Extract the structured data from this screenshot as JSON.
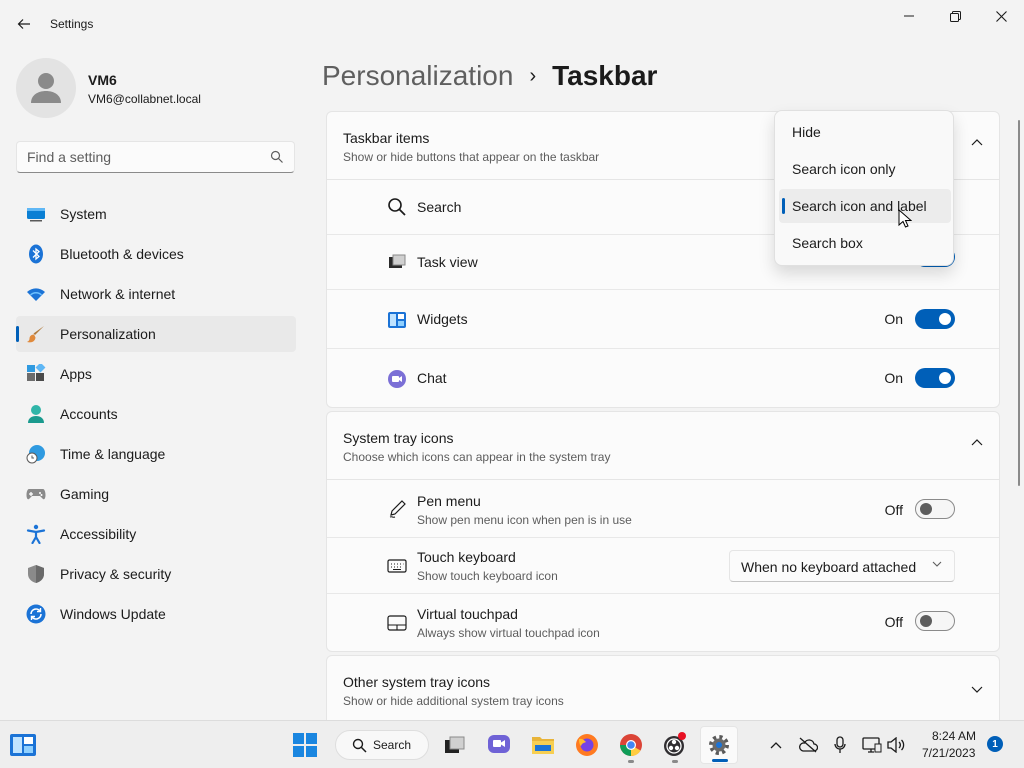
{
  "window": {
    "title": "Settings"
  },
  "profile": {
    "name": "VM6",
    "email": "VM6@collabnet.local"
  },
  "search": {
    "placeholder": "Find a setting"
  },
  "sidebar": {
    "items": [
      {
        "label": "System",
        "icon": "system-icon"
      },
      {
        "label": "Bluetooth & devices",
        "icon": "bluetooth-icon"
      },
      {
        "label": "Network & internet",
        "icon": "wifi-icon"
      },
      {
        "label": "Personalization",
        "icon": "brush-icon",
        "selected": true
      },
      {
        "label": "Apps",
        "icon": "apps-icon"
      },
      {
        "label": "Accounts",
        "icon": "accounts-icon"
      },
      {
        "label": "Time & language",
        "icon": "globe-clock-icon"
      },
      {
        "label": "Gaming",
        "icon": "gamepad-icon"
      },
      {
        "label": "Accessibility",
        "icon": "accessibility-icon"
      },
      {
        "label": "Privacy & security",
        "icon": "shield-icon"
      },
      {
        "label": "Windows Update",
        "icon": "update-icon"
      }
    ]
  },
  "breadcrumb": {
    "parent": "Personalization",
    "current": "Taskbar"
  },
  "taskbar_items": {
    "title": "Taskbar items",
    "subtitle": "Show or hide buttons that appear on the taskbar",
    "rows": [
      {
        "label": "Search",
        "icon": "search-icon"
      },
      {
        "label": "Task view",
        "icon": "task-view-icon"
      },
      {
        "label": "Widgets",
        "state": "On",
        "on": true,
        "icon": "widgets-icon"
      },
      {
        "label": "Chat",
        "state": "On",
        "on": true,
        "icon": "chat-icon"
      }
    ]
  },
  "search_flyout": {
    "options": [
      "Hide",
      "Search icon only",
      "Search icon and label",
      "Search box"
    ],
    "selected": "Search icon and label"
  },
  "system_tray": {
    "title": "System tray icons",
    "subtitle": "Choose which icons can appear in the system tray",
    "rows": [
      {
        "label": "Pen menu",
        "sub": "Show pen menu icon when pen is in use",
        "state": "Off",
        "on": false,
        "icon": "pen-icon"
      },
      {
        "label": "Touch keyboard",
        "sub": "Show touch keyboard icon",
        "select": "When no keyboard attached",
        "icon": "keyboard-icon"
      },
      {
        "label": "Virtual touchpad",
        "sub": "Always show virtual touchpad icon",
        "state": "Off",
        "on": false,
        "icon": "touchpad-icon"
      }
    ]
  },
  "other_tray": {
    "title": "Other system tray icons",
    "subtitle": "Show or hide additional system tray icons"
  },
  "taskbar": {
    "search_label": "Search",
    "time": "8:24 AM",
    "date": "7/21/2023",
    "notification_count": "1"
  },
  "colors": {
    "accent": "#005fb8",
    "background": "#f3f3f3",
    "card": "#fbfbfb"
  }
}
